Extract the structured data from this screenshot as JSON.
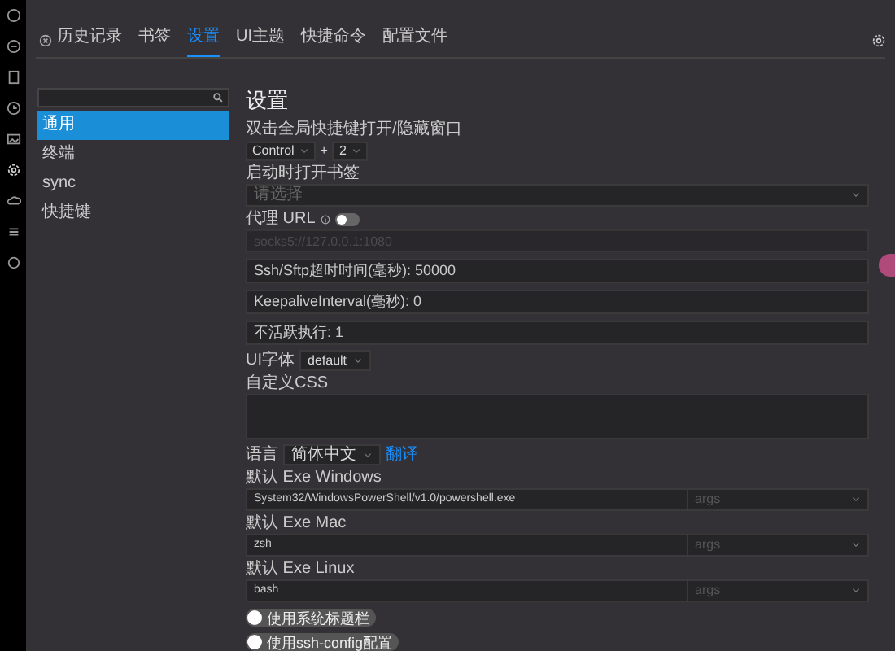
{
  "tabs": [
    {
      "label": "历史记录",
      "selected": false
    },
    {
      "label": "书签",
      "selected": false
    },
    {
      "label": "设置",
      "selected": true
    },
    {
      "label": "UI主题",
      "selected": false
    },
    {
      "label": "快捷命令",
      "selected": false
    },
    {
      "label": "配置文件",
      "selected": false
    }
  ],
  "menu": [
    {
      "label": "通用",
      "selected": true
    },
    {
      "label": "终端",
      "selected": false
    },
    {
      "label": "sync",
      "selected": false
    },
    {
      "label": "快捷键",
      "selected": false
    }
  ],
  "settings": {
    "title": "设置",
    "hotkey": {
      "label": "双击全局快捷键打开/隐藏窗口",
      "modifier": "Control",
      "plus": "+",
      "key": "2"
    },
    "open_bookmark": {
      "label": "启动时打开书签",
      "placeholder": "请选择"
    },
    "proxy": {
      "label": "代理 URL",
      "on": false,
      "placeholder": "socks5://127.0.0.1:1080"
    },
    "fields": [
      {
        "value": "Ssh/Sftp超时时间(毫秒): 50000"
      },
      {
        "value": "KeepaliveInterval(毫秒): 0"
      },
      {
        "value": "不活跃执行: 1"
      }
    ],
    "ui_font": {
      "label": "UI字体",
      "value": "default"
    },
    "custom_css": {
      "label": "自定义CSS"
    },
    "language": {
      "label": "语言",
      "value": "简体中文",
      "link": "翻译"
    },
    "exes": [
      {
        "label": "默认 Exe Windows",
        "value": "System32/WindowsPowerShell/v1.0/powershell.exe",
        "args": "args"
      },
      {
        "label": "默认 Exe Mac",
        "value": "zsh",
        "args": "args"
      },
      {
        "label": "默认 Exe Linux",
        "value": "bash",
        "args": "args"
      }
    ],
    "toggles": [
      {
        "label": "使用系统标题栏",
        "on": false
      },
      {
        "label": "使用ssh-config配置",
        "on": false
      }
    ]
  }
}
